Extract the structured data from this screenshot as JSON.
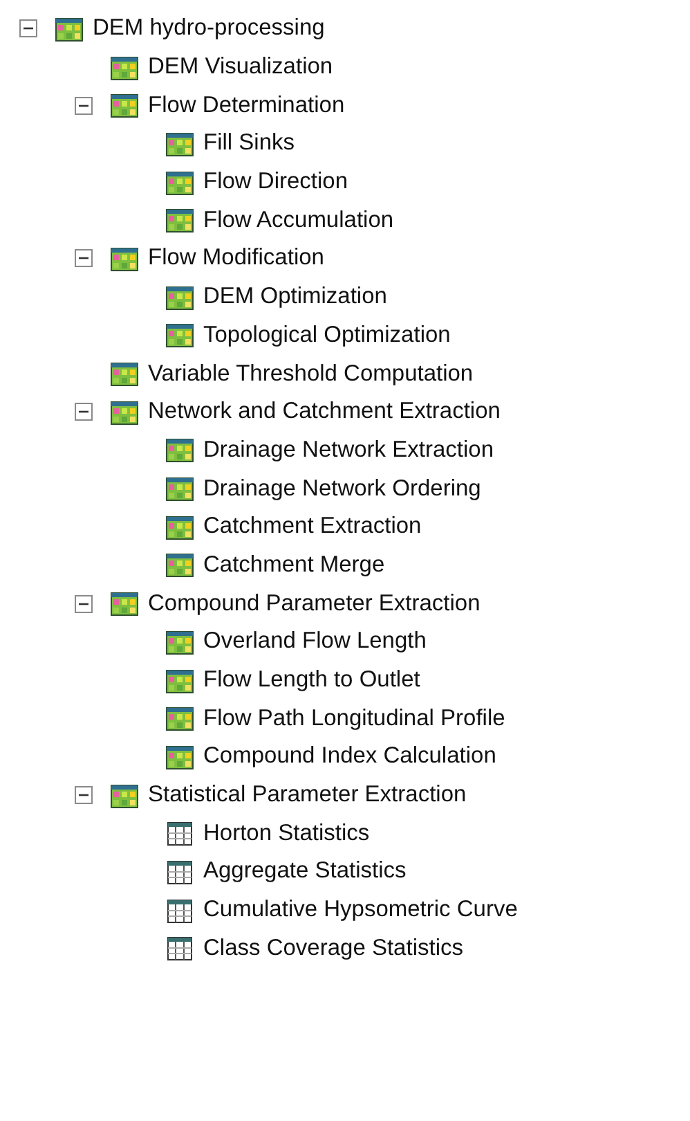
{
  "tree": [
    {
      "label": "DEM hydro-processing",
      "kind": "raster",
      "expanded": true,
      "children": [
        {
          "label": "DEM Visualization",
          "kind": "raster"
        },
        {
          "label": "Flow Determination",
          "kind": "raster",
          "expanded": true,
          "children": [
            {
              "label": "Fill Sinks",
              "kind": "raster"
            },
            {
              "label": "Flow Direction",
              "kind": "raster"
            },
            {
              "label": "Flow Accumulation",
              "kind": "raster"
            }
          ]
        },
        {
          "label": "Flow Modification",
          "kind": "raster",
          "expanded": true,
          "children": [
            {
              "label": "DEM Optimization",
              "kind": "raster"
            },
            {
              "label": "Topological Optimization",
              "kind": "raster"
            }
          ]
        },
        {
          "label": "Variable Threshold Computation",
          "kind": "raster"
        },
        {
          "label": "Network and Catchment Extraction",
          "kind": "raster",
          "expanded": true,
          "children": [
            {
              "label": "Drainage Network Extraction",
              "kind": "raster"
            },
            {
              "label": "Drainage Network Ordering",
              "kind": "raster"
            },
            {
              "label": "Catchment Extraction",
              "kind": "raster"
            },
            {
              "label": "Catchment Merge",
              "kind": "raster"
            }
          ]
        },
        {
          "label": "Compound Parameter Extraction",
          "kind": "raster",
          "expanded": true,
          "children": [
            {
              "label": "Overland Flow Length",
              "kind": "raster"
            },
            {
              "label": "Flow Length to Outlet",
              "kind": "raster"
            },
            {
              "label": "Flow Path Longitudinal Profile",
              "kind": "raster"
            },
            {
              "label": "Compound Index Calculation",
              "kind": "raster"
            }
          ]
        },
        {
          "label": "Statistical Parameter Extraction",
          "kind": "raster",
          "expanded": true,
          "children": [
            {
              "label": "Horton Statistics",
              "kind": "table"
            },
            {
              "label": "Aggregate Statistics",
              "kind": "table"
            },
            {
              "label": "Cumulative Hypsometric Curve",
              "kind": "table"
            },
            {
              "label": "Class Coverage Statistics",
              "kind": "table"
            }
          ]
        }
      ]
    }
  ]
}
